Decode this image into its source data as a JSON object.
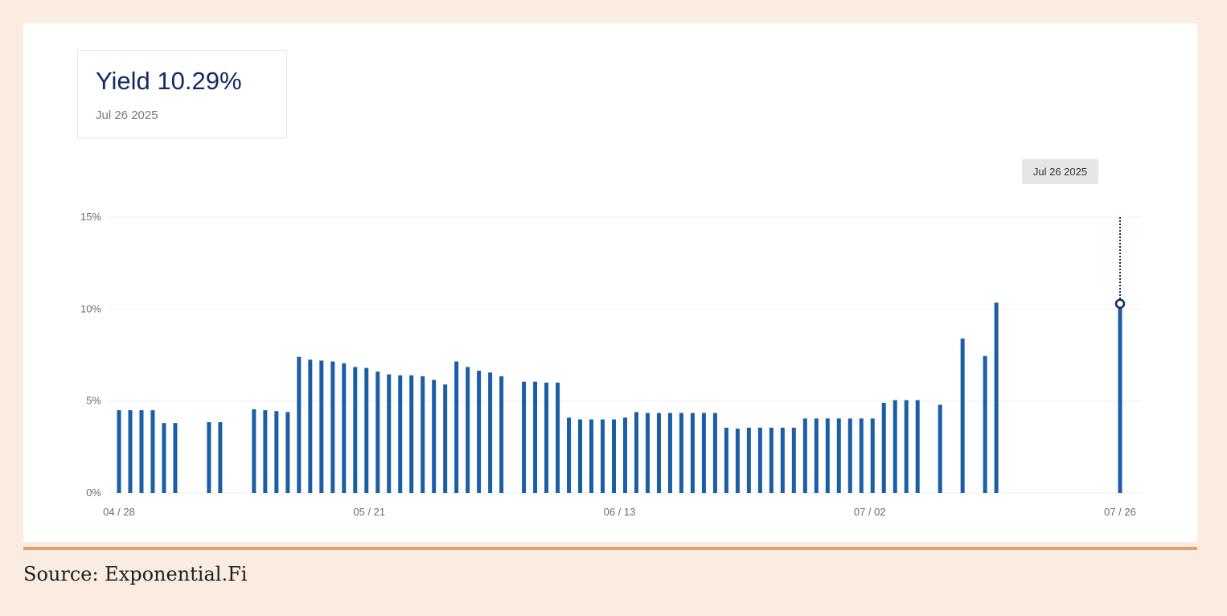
{
  "header": {
    "title": "Yield 10.29%",
    "date": "Jul 26 2025"
  },
  "tooltip": {
    "label": "Jul 26 2025"
  },
  "source": "Source: Exponential.Fi",
  "colors": {
    "bar": "#1b5ea6",
    "line": "#0f2a66",
    "background": "#fbece1",
    "rule": "#e0a070"
  },
  "chart_data": {
    "type": "bar",
    "x_start": "2025-04-28",
    "x_end": "2025-07-26",
    "xticks": [
      "04 / 28",
      "05 / 21",
      "06 / 13",
      "07 / 02",
      "07 / 26"
    ],
    "yticks": [
      "0%",
      "5%",
      "10%",
      "15%"
    ],
    "ylim": [
      0,
      15
    ],
    "grid": true,
    "highlight": {
      "date": "2025-07-26",
      "value": 10.29
    },
    "series": [
      {
        "points": [
          [
            "2025-04-28",
            4.5
          ],
          [
            "2025-04-29",
            4.5
          ],
          [
            "2025-04-30",
            4.5
          ],
          [
            "2025-05-01",
            4.5
          ],
          [
            "2025-05-02",
            3.8
          ],
          [
            "2025-05-03",
            3.8
          ],
          [
            "2025-05-06",
            3.85
          ],
          [
            "2025-05-07",
            3.85
          ],
          [
            "2025-05-10",
            4.55
          ],
          [
            "2025-05-11",
            4.5
          ],
          [
            "2025-05-12",
            4.45
          ],
          [
            "2025-05-13",
            4.4
          ],
          [
            "2025-05-14",
            7.4
          ],
          [
            "2025-05-15",
            7.25
          ],
          [
            "2025-05-16",
            7.2
          ],
          [
            "2025-05-17",
            7.15
          ],
          [
            "2025-05-18",
            7.05
          ],
          [
            "2025-05-19",
            6.85
          ],
          [
            "2025-05-20",
            6.8
          ],
          [
            "2025-05-21",
            6.6
          ],
          [
            "2025-05-22",
            6.45
          ],
          [
            "2025-05-23",
            6.4
          ],
          [
            "2025-05-24",
            6.4
          ],
          [
            "2025-05-25",
            6.35
          ],
          [
            "2025-05-26",
            6.15
          ],
          [
            "2025-05-27",
            5.9
          ],
          [
            "2025-05-28",
            7.15
          ],
          [
            "2025-05-29",
            6.85
          ],
          [
            "2025-05-30",
            6.65
          ],
          [
            "2025-05-31",
            6.55
          ],
          [
            "2025-06-01",
            6.35
          ],
          [
            "2025-06-03",
            6.05
          ],
          [
            "2025-06-04",
            6.05
          ],
          [
            "2025-06-05",
            6.0
          ],
          [
            "2025-06-06",
            6.0
          ],
          [
            "2025-06-07",
            4.1
          ],
          [
            "2025-06-08",
            4.0
          ],
          [
            "2025-06-09",
            4.0
          ],
          [
            "2025-06-10",
            4.0
          ],
          [
            "2025-06-11",
            4.0
          ],
          [
            "2025-06-12",
            4.1
          ],
          [
            "2025-06-13",
            4.4
          ],
          [
            "2025-06-14",
            4.35
          ],
          [
            "2025-06-15",
            4.35
          ],
          [
            "2025-06-16",
            4.35
          ],
          [
            "2025-06-17",
            4.35
          ],
          [
            "2025-06-18",
            4.35
          ],
          [
            "2025-06-19",
            4.35
          ],
          [
            "2025-06-20",
            4.35
          ],
          [
            "2025-06-21",
            3.55
          ],
          [
            "2025-06-22",
            3.5
          ],
          [
            "2025-06-23",
            3.55
          ],
          [
            "2025-06-24",
            3.55
          ],
          [
            "2025-06-25",
            3.55
          ],
          [
            "2025-06-26",
            3.55
          ],
          [
            "2025-06-27",
            3.55
          ],
          [
            "2025-06-28",
            4.05
          ],
          [
            "2025-06-29",
            4.05
          ],
          [
            "2025-06-30",
            4.05
          ],
          [
            "2025-07-01",
            4.05
          ],
          [
            "2025-07-02",
            4.05
          ],
          [
            "2025-07-03",
            4.05
          ],
          [
            "2025-07-04",
            4.05
          ],
          [
            "2025-07-05",
            4.9
          ],
          [
            "2025-07-06",
            5.05
          ],
          [
            "2025-07-07",
            5.05
          ],
          [
            "2025-07-08",
            5.05
          ],
          [
            "2025-07-10",
            4.8
          ],
          [
            "2025-07-12",
            8.4
          ],
          [
            "2025-07-14",
            7.45
          ],
          [
            "2025-07-15",
            10.35
          ],
          [
            "2025-07-26",
            10.29
          ]
        ]
      }
    ]
  }
}
